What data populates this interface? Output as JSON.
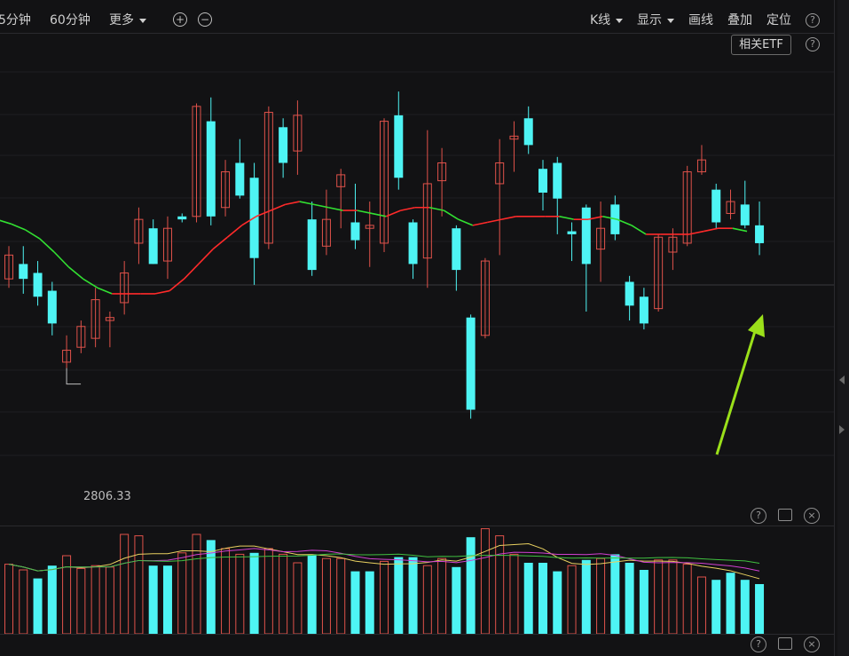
{
  "toolbar": {
    "periods": [
      "5分钟",
      "60分钟"
    ],
    "more_label": "更多",
    "zoom_in_icon": "plus-circle-icon",
    "zoom_out_icon": "minus-circle-icon",
    "kline_label": "K线",
    "display_label": "显示",
    "draw_label": "画线",
    "overlay_label": "叠加",
    "locate_label": "定位",
    "help_icon": "question-circle-icon"
  },
  "related_etf_label": "相关ETF",
  "price_panel": {
    "low_label": "2806.33",
    "colors": {
      "up": "#e0524a",
      "down": "#4ef4f4",
      "ma_up": "#ff2a2a",
      "ma_down": "#32e032"
    },
    "annotation_arrow_color": "#9be01a"
  },
  "volume_panel": {
    "icons": [
      "question-circle-icon",
      "expand-icon",
      "close-icon"
    ],
    "line_colors": [
      "#e8d060",
      "#d040d0",
      "#40c040"
    ]
  },
  "bottom_panel": {
    "icons": [
      "question-circle-icon",
      "expand-icon",
      "close-icon"
    ]
  },
  "chart_data": {
    "type": "candlestick",
    "low_marker": "2806.33",
    "candles": [
      {
        "o": 31,
        "c": 39,
        "h": 42,
        "l": 28
      },
      {
        "o": 36,
        "c": 31,
        "h": 42,
        "l": 26
      },
      {
        "o": 33,
        "c": 25,
        "h": 37,
        "l": 22
      },
      {
        "o": 27,
        "c": 16,
        "h": 30,
        "l": 12
      },
      {
        "o": 3,
        "c": 7,
        "h": 12,
        "l": 1
      },
      {
        "o": 8,
        "c": 15,
        "h": 17,
        "l": 6
      },
      {
        "o": 11,
        "c": 24,
        "h": 28,
        "l": 8
      },
      {
        "o": 17,
        "c": 18,
        "h": 20,
        "l": 8
      },
      {
        "o": 23,
        "c": 33,
        "h": 37,
        "l": 19
      },
      {
        "o": 43,
        "c": 51,
        "h": 55,
        "l": 36
      },
      {
        "o": 48,
        "c": 36,
        "h": 51,
        "l": 36
      },
      {
        "o": 37,
        "c": 48,
        "h": 52,
        "l": 31
      },
      {
        "o": 52,
        "c": 51,
        "h": 53,
        "l": 50
      },
      {
        "o": 52,
        "c": 89,
        "h": 90,
        "l": 50
      },
      {
        "o": 84,
        "c": 52,
        "h": 92,
        "l": 49
      },
      {
        "o": 55,
        "c": 67,
        "h": 71,
        "l": 52
      },
      {
        "o": 70,
        "c": 59,
        "h": 78,
        "l": 58
      },
      {
        "o": 65,
        "c": 38,
        "h": 70,
        "l": 29
      },
      {
        "o": 43,
        "c": 87,
        "h": 89,
        "l": 41
      },
      {
        "o": 82,
        "c": 70,
        "h": 85,
        "l": 65
      },
      {
        "o": 74,
        "c": 86,
        "h": 91,
        "l": 66
      },
      {
        "o": 51,
        "c": 34,
        "h": 57,
        "l": 32
      },
      {
        "o": 42,
        "c": 51,
        "h": 61,
        "l": 39
      },
      {
        "o": 62,
        "c": 66,
        "h": 68,
        "l": 48
      },
      {
        "o": 50,
        "c": 44,
        "h": 63,
        "l": 41
      },
      {
        "o": 48,
        "c": 49,
        "h": 57,
        "l": 35
      },
      {
        "o": 43,
        "c": 84,
        "h": 85,
        "l": 40
      },
      {
        "o": 86,
        "c": 65,
        "h": 94,
        "l": 61
      },
      {
        "o": 50,
        "c": 36,
        "h": 51,
        "l": 31
      },
      {
        "o": 38,
        "c": 63,
        "h": 81,
        "l": 28
      },
      {
        "o": 64,
        "c": 70,
        "h": 75,
        "l": 52
      },
      {
        "o": 48,
        "c": 34,
        "h": 49,
        "l": 27
      },
      {
        "o": 18,
        "c": -13,
        "h": 19,
        "l": -16
      },
      {
        "o": 12,
        "c": 37,
        "h": 38,
        "l": 11
      },
      {
        "o": 63,
        "c": 70,
        "h": 78,
        "l": 39
      },
      {
        "o": 78,
        "c": 79,
        "h": 84,
        "l": 67
      },
      {
        "o": 85,
        "c": 76,
        "h": 89,
        "l": 73
      },
      {
        "o": 68,
        "c": 60,
        "h": 71,
        "l": 54
      },
      {
        "o": 70,
        "c": 58,
        "h": 72,
        "l": 46
      },
      {
        "o": 47,
        "c": 46,
        "h": 50,
        "l": 37
      },
      {
        "o": 55,
        "c": 36,
        "h": 56,
        "l": 20
      },
      {
        "o": 41,
        "c": 48,
        "h": 57,
        "l": 30
      },
      {
        "o": 56,
        "c": 46,
        "h": 59,
        "l": 44
      },
      {
        "o": 30,
        "c": 22,
        "h": 32,
        "l": 17
      },
      {
        "o": 25,
        "c": 16,
        "h": 28,
        "l": 14
      },
      {
        "o": 21,
        "c": 45,
        "h": 46,
        "l": 20
      },
      {
        "o": 40,
        "c": 45,
        "h": 48,
        "l": 34
      },
      {
        "o": 43,
        "c": 67,
        "h": 69,
        "l": 42
      },
      {
        "o": 67,
        "c": 71,
        "h": 76,
        "l": 66
      },
      {
        "o": 61,
        "c": 50,
        "h": 63,
        "l": 48
      },
      {
        "o": 53,
        "c": 57,
        "h": 61,
        "l": 51
      },
      {
        "o": 56,
        "c": 49,
        "h": 64,
        "l": 48
      },
      {
        "o": 49,
        "c": 43,
        "h": 57,
        "l": 39
      }
    ],
    "ma": [
      51,
      49.5,
      47.5,
      44.5,
      40,
      35,
      31,
      28,
      26,
      26,
      26,
      26,
      27,
      31,
      36,
      41,
      45,
      49,
      52,
      54,
      56,
      57,
      56,
      55,
      54,
      54,
      53,
      52,
      54,
      55,
      55,
      54,
      51,
      49,
      50,
      51,
      52,
      52,
      52,
      52,
      51,
      51,
      52,
      51,
      49,
      46,
      46,
      46,
      46,
      47,
      48,
      48,
      47
    ],
    "volumes": [
      {
        "v": 49,
        "up": true
      },
      {
        "v": 45,
        "up": true
      },
      {
        "v": 39,
        "up": false
      },
      {
        "v": 48,
        "up": false
      },
      {
        "v": 55,
        "up": true
      },
      {
        "v": 46,
        "up": true
      },
      {
        "v": 48,
        "up": true
      },
      {
        "v": 47,
        "up": true
      },
      {
        "v": 70,
        "up": true
      },
      {
        "v": 69,
        "up": true
      },
      {
        "v": 48,
        "up": false
      },
      {
        "v": 48,
        "up": false
      },
      {
        "v": 57,
        "up": true
      },
      {
        "v": 70,
        "up": true
      },
      {
        "v": 66,
        "up": false
      },
      {
        "v": 60,
        "up": true
      },
      {
        "v": 56,
        "up": true
      },
      {
        "v": 57,
        "up": false
      },
      {
        "v": 60,
        "up": true
      },
      {
        "v": 56,
        "up": true
      },
      {
        "v": 50,
        "up": true
      },
      {
        "v": 56,
        "up": false
      },
      {
        "v": 53,
        "up": true
      },
      {
        "v": 53,
        "up": true
      },
      {
        "v": 44,
        "up": false
      },
      {
        "v": 44,
        "up": false
      },
      {
        "v": 51,
        "up": true
      },
      {
        "v": 54,
        "up": false
      },
      {
        "v": 54,
        "up": false
      },
      {
        "v": 48,
        "up": true
      },
      {
        "v": 53,
        "up": true
      },
      {
        "v": 47,
        "up": false
      },
      {
        "v": 68,
        "up": false
      },
      {
        "v": 74,
        "up": true
      },
      {
        "v": 69,
        "up": true
      },
      {
        "v": 56,
        "up": true
      },
      {
        "v": 50,
        "up": false
      },
      {
        "v": 50,
        "up": false
      },
      {
        "v": 44,
        "up": false
      },
      {
        "v": 48,
        "up": true
      },
      {
        "v": 52,
        "up": false
      },
      {
        "v": 53,
        "up": true
      },
      {
        "v": 56,
        "up": false
      },
      {
        "v": 50,
        "up": false
      },
      {
        "v": 45,
        "up": false
      },
      {
        "v": 52,
        "up": true
      },
      {
        "v": 52,
        "up": true
      },
      {
        "v": 49,
        "up": true
      },
      {
        "v": 40,
        "up": true
      },
      {
        "v": 38,
        "up": false
      },
      {
        "v": 43,
        "up": false
      },
      {
        "v": 38,
        "up": false
      },
      {
        "v": 35,
        "up": false
      }
    ]
  }
}
